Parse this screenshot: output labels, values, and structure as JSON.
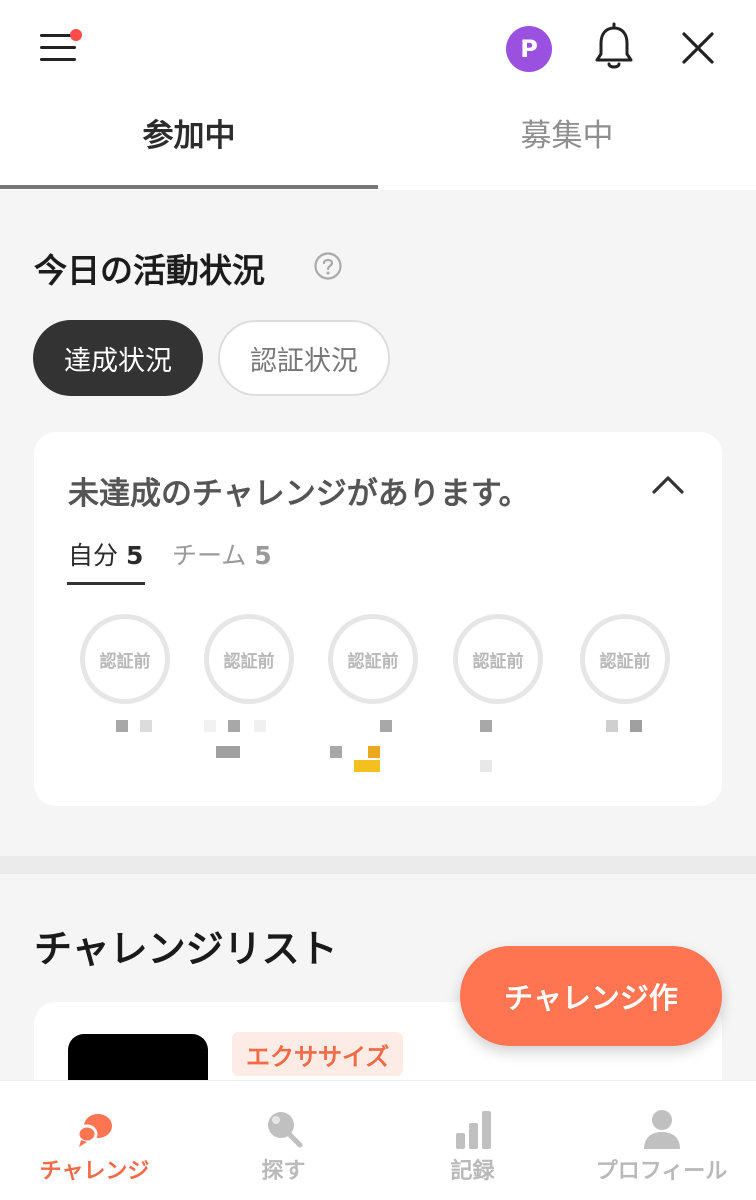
{
  "header": {
    "avatar_initial": "P",
    "tabs": [
      {
        "label": "参加中",
        "active": true
      },
      {
        "label": "募集中",
        "active": false
      }
    ]
  },
  "activity": {
    "title": "今日の活動状況",
    "toggles": [
      {
        "label": "達成状況",
        "active": true
      },
      {
        "label": "認証状況",
        "active": false
      }
    ],
    "card": {
      "title": "未達成のチャレンジがあります。",
      "sub_tabs": [
        {
          "label": "自分",
          "count": "5"
        },
        {
          "label": "チーム",
          "count": "5"
        }
      ],
      "badges": [
        "認証前",
        "認証前",
        "認証前",
        "認証前",
        "認証前"
      ]
    }
  },
  "list": {
    "title": "チャレンジリスト",
    "first_item_tag": "エクササイズ"
  },
  "fab_label": "チャレンジ作",
  "bottom_nav": [
    {
      "label": "チャレンジ",
      "icon": "chat-bubbles-icon",
      "active": true
    },
    {
      "label": "探す",
      "icon": "search-icon",
      "active": false
    },
    {
      "label": "記録",
      "icon": "bar-chart-icon",
      "active": false
    },
    {
      "label": "プロフィール",
      "icon": "user-icon",
      "active": false
    }
  ],
  "colors": {
    "accent": "#ff7451",
    "accent_text": "#f26b48",
    "avatar": "#9b51e0",
    "notification_dot": "#ff4a4a"
  }
}
